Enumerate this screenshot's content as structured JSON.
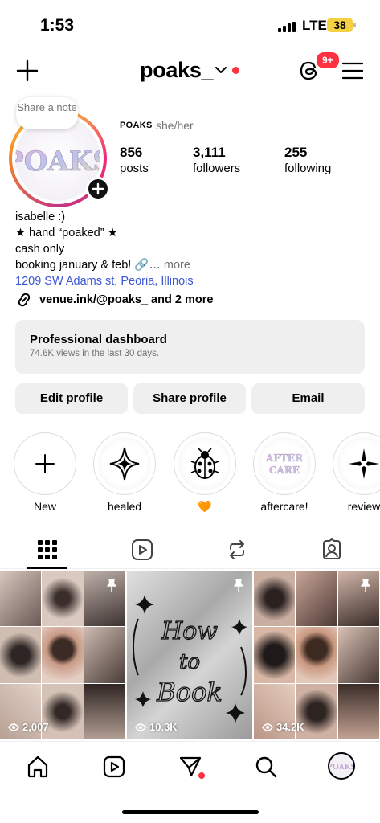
{
  "status_bar": {
    "time": "1:53",
    "network": "LTE",
    "battery": "38"
  },
  "top_nav": {
    "username": "poaks_",
    "threads_badge": "9+"
  },
  "note": {
    "text": "Share a note"
  },
  "profile": {
    "name": "POAKS",
    "pronouns": "she/her",
    "stats": [
      {
        "value": "856",
        "label": "posts"
      },
      {
        "value": "3,111",
        "label": "followers"
      },
      {
        "value": "255",
        "label": "following"
      }
    ]
  },
  "bio": {
    "line1": "isabelle :)",
    "line2": "★ hand “poaked” ★",
    "line3": "cash only",
    "line4": "booking january & feb! 🔗…",
    "more": "more",
    "address": "1209 SW Adams st, Peoria, Illinois",
    "links": "venue.ink/@poaks_ and 2 more"
  },
  "dashboard": {
    "title": "Professional dashboard",
    "subtitle": "74.6K views in the last 30 days."
  },
  "actions": {
    "edit": "Edit profile",
    "share": "Share profile",
    "email": "Email"
  },
  "highlights": [
    {
      "label": "New",
      "icon": "plus-icon"
    },
    {
      "label": "healed",
      "icon": "sparkle-icon"
    },
    {
      "label": "🧡",
      "icon": "ladybug-icon"
    },
    {
      "label": "aftercare!",
      "icon": "aftercare-logo"
    },
    {
      "label": "review",
      "icon": "star-icon"
    }
  ],
  "tabs": [
    "grid",
    "reels",
    "reposts",
    "tagged"
  ],
  "posts": [
    {
      "views": "2,007",
      "pinned": true
    },
    {
      "views": "10.3K",
      "pinned": true,
      "script_text": "How to Book"
    },
    {
      "views": "34.2K",
      "pinned": true
    }
  ],
  "colors": {
    "accent_red": "#ff3040",
    "link_blue": "#3a55d6",
    "battery": "#f5d142"
  }
}
